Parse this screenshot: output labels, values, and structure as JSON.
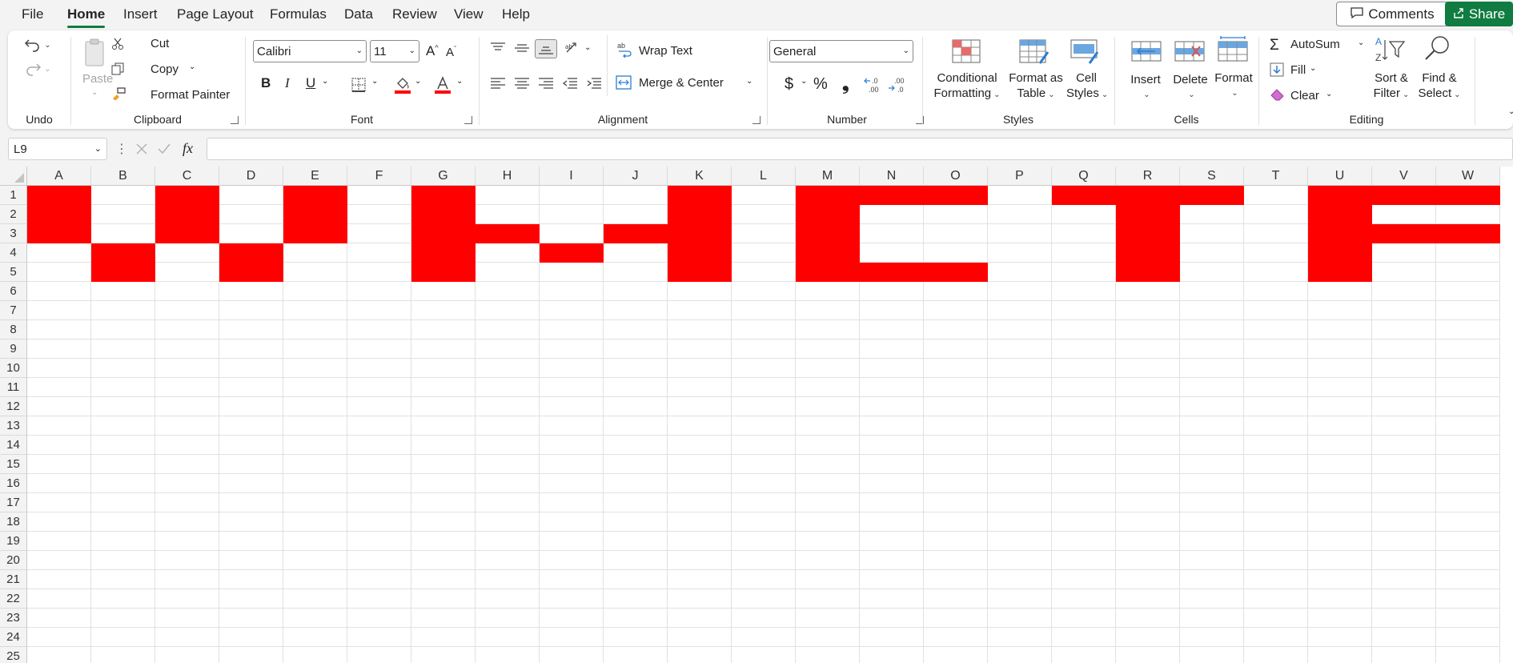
{
  "menu": {
    "tabs": [
      "File",
      "Home",
      "Insert",
      "Page Layout",
      "Formulas",
      "Data",
      "Review",
      "View",
      "Help"
    ],
    "active_tab": "Home",
    "comments_label": "Comments",
    "share_label": "Share"
  },
  "ribbon": {
    "undo": {
      "group_label": "Undo"
    },
    "clipboard": {
      "paste_label": "Paste",
      "cut_label": "Cut",
      "copy_label": "Copy",
      "format_painter_label": "Format Painter",
      "group_label": "Clipboard"
    },
    "font": {
      "font_name": "Calibri",
      "font_size": "11",
      "bold": "B",
      "italic": "I",
      "underline": "U",
      "group_label": "Font",
      "fill_color": "#ff0000",
      "font_color": "#ff0000"
    },
    "alignment": {
      "wrap_text_label": "Wrap Text",
      "merge_center_label": "Merge & Center",
      "group_label": "Alignment"
    },
    "number": {
      "format": "General",
      "currency": "$",
      "percent": "%",
      "comma": "❟",
      "group_label": "Number"
    },
    "styles": {
      "conditional_formatting": [
        "Conditional",
        "Formatting"
      ],
      "format_as_table": [
        "Format as",
        "Table"
      ],
      "cell_styles": [
        "Cell",
        "Styles"
      ],
      "group_label": "Styles"
    },
    "cells": {
      "insert_label": "Insert",
      "delete_label": "Delete",
      "format_label": "Format",
      "group_label": "Cells"
    },
    "editing": {
      "autosum_label": "AutoSum",
      "fill_label": "Fill",
      "clear_label": "Clear",
      "sort_filter": [
        "Sort &",
        "Filter"
      ],
      "find_select": [
        "Find &",
        "Select"
      ],
      "group_label": "Editing"
    }
  },
  "formula_bar": {
    "name_box": "L9",
    "fx_label": "fx",
    "formula": ""
  },
  "sheet": {
    "columns": [
      "A",
      "B",
      "C",
      "D",
      "E",
      "F",
      "G",
      "H",
      "I",
      "J",
      "K",
      "L",
      "M",
      "N",
      "O",
      "P",
      "Q",
      "R",
      "S",
      "T",
      "U",
      "V",
      "W"
    ],
    "rows": [
      "1",
      "2",
      "3",
      "4",
      "5",
      "6",
      "7",
      "8",
      "9",
      "10",
      "11",
      "12",
      "13",
      "14",
      "15",
      "16",
      "17",
      "18",
      "19",
      "20",
      "21",
      "22",
      "23",
      "24",
      "25"
    ],
    "fill_color": "#ff0000",
    "red_cells": {
      "A": [
        1,
        2,
        3
      ],
      "B": [
        4,
        5
      ],
      "C": [
        1,
        2,
        3
      ],
      "D": [
        4,
        5
      ],
      "E": [
        1,
        2,
        3
      ],
      "G": [
        1,
        2,
        3,
        4,
        5
      ],
      "H": [
        3
      ],
      "I": [
        4
      ],
      "J": [
        3
      ],
      "K": [
        1,
        2,
        3,
        4,
        5
      ],
      "M": [
        1,
        2,
        3,
        4,
        5
      ],
      "N": [
        1,
        5
      ],
      "O": [
        1,
        5
      ],
      "Q": [
        1
      ],
      "R": [
        1,
        2,
        3,
        4,
        5
      ],
      "S": [
        1
      ],
      "U": [
        1,
        2,
        3,
        4,
        5
      ],
      "V": [
        1,
        3
      ],
      "W": [
        1,
        3
      ]
    }
  }
}
